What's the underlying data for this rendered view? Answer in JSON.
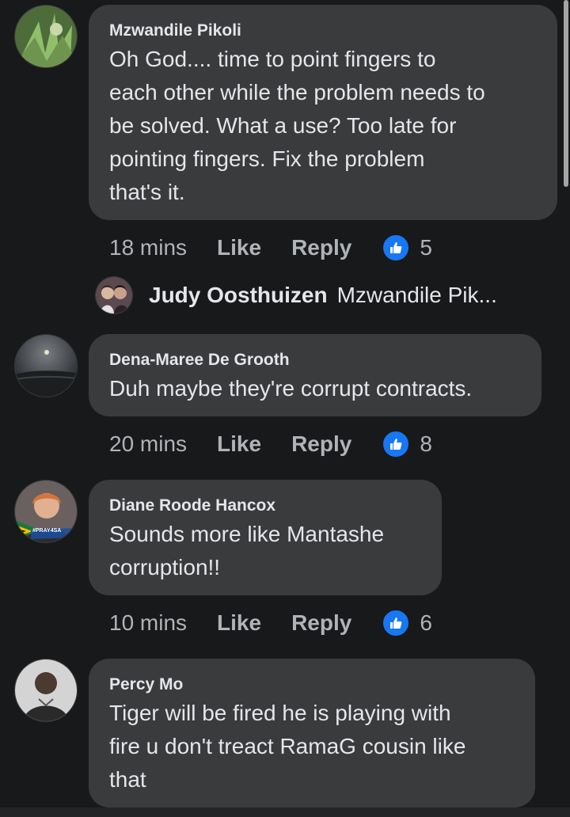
{
  "comments": [
    {
      "author": "Mzwandile Pikoli",
      "lines": [
        "Oh God.... time to point fingers to",
        "each other while the problem needs to",
        "be solved.  What a use? Too late for",
        "pointing fingers. Fix the problem",
        "that's it."
      ],
      "time": "18 mins",
      "like_label": "Like",
      "reply_label": "Reply",
      "reactions": "5"
    },
    {
      "author": "Dena-Maree De Grooth",
      "lines": [
        "Duh maybe they're corrupt contracts."
      ],
      "time": "20 mins",
      "like_label": "Like",
      "reply_label": "Reply",
      "reactions": "8"
    },
    {
      "author": "Diane Roode Hancox",
      "lines": [
        "Sounds more like Mantashe",
        "corruption!!"
      ],
      "time": "10 mins",
      "like_label": "Like",
      "reply_label": "Reply",
      "reactions": "6",
      "avatar_badge": "#PRAY4SA"
    },
    {
      "author": "Percy Mo",
      "lines": [
        "Tiger  will be fired he is playing with",
        "fire u don't treact RamaG cousin like",
        "that"
      ]
    }
  ],
  "reply_preview": {
    "author": "Judy Oosthuizen",
    "text": "Mzwandile Pik..."
  },
  "colors": {
    "background": "#18191a",
    "bubble": "#3a3b3c",
    "like_blue": "#1877f2",
    "meta_text": "#b0b3b8"
  },
  "icons": {
    "reaction": "thumbs-up-icon"
  }
}
